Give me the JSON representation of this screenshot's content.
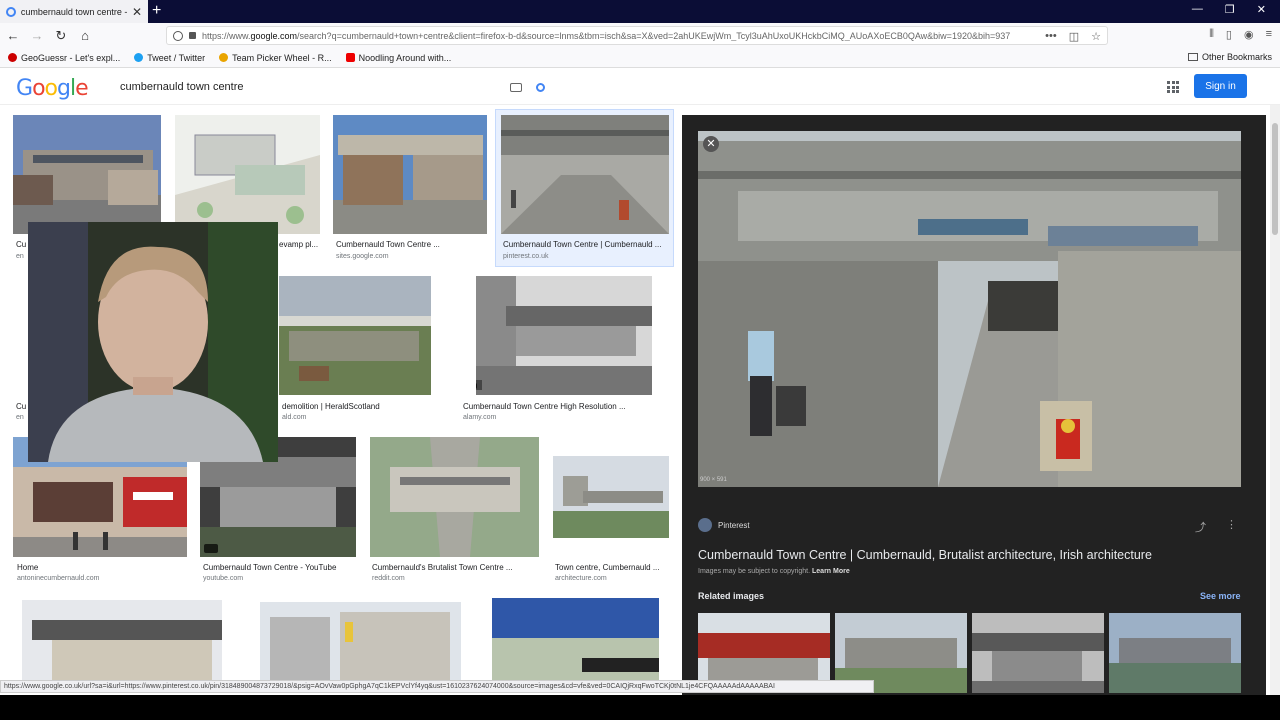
{
  "browser": {
    "tab_title": "cumbernauld town centre - Go",
    "url_prefix": "https://www.",
    "url_host": "google.com",
    "url_rest": "/search?q=cumbernauld+town+centre&client=firefox-b-d&source=lnms&tbm=isch&sa=X&ved=2ahUKEwjWm_Tcyl3uAhUxoUKHckbCiMQ_AUoAXoECB0QAw&biw=1920&bih=937",
    "bookmarks": [
      {
        "label": "GeoGuessr - Let's expl...",
        "color": "#c00"
      },
      {
        "label": "Tweet / Twitter",
        "color": "#1da1f2"
      },
      {
        "label": "Team Picker Wheel - R...",
        "color": "#e9a400"
      },
      {
        "label": "Noodling Around with...",
        "color": "#e00"
      }
    ],
    "other_bookmarks": "Other Bookmarks"
  },
  "google": {
    "logo": "Google",
    "query": "cumbernauld town centre",
    "signin": "Sign in"
  },
  "results": [
    {
      "caption": "Cu",
      "source": "en"
    },
    {
      "caption": "evamp pl...",
      "source": ""
    },
    {
      "caption": "Cumbernauld Town Centre ...",
      "source": "sites.google.com"
    },
    {
      "caption": "Cumbernauld Town Centre | Cumbernauld ...",
      "source": "pinterest.co.uk"
    },
    {
      "caption": "Cu",
      "source": "en"
    },
    {
      "caption": "demolition | HeraldScotland",
      "source": "ald.com"
    },
    {
      "caption": "Cumbernauld Town Centre High Resolution ...",
      "source": "alamy.com"
    },
    {
      "caption": "Home",
      "source": "antoninecumbernauld.com"
    },
    {
      "caption": "Cumbernauld Town Centre - YouTube",
      "source": "youtube.com"
    },
    {
      "caption": "Cumbernauld's Brutalist Town Centre ...",
      "source": "reddit.com"
    },
    {
      "caption": "Town centre, Cumbernauld ...",
      "source": "architecture.com"
    }
  ],
  "preview": {
    "dimensions": "900 × 591",
    "source": "Pinterest",
    "title": "Cumbernauld Town Centre | Cumbernauld, Brutalist architecture, Irish architecture",
    "copyright": "Images may be subject to copyright.",
    "learn_more": "Learn More",
    "related_heading": "Related images",
    "see_more": "See more"
  },
  "status_url": "https://www.google.co.uk/url?sa=i&url=https://www.pinterest.co.uk/pin/318489004873729018/&psig=AOvVaw0pGphgA7qC1kEPVclYf4yq&ust=1610237624074000&source=images&cd=vfe&ved=0CAIQjRxqFwoTCKj0tNL1je4CFQAAAAAdAAAAABAI"
}
